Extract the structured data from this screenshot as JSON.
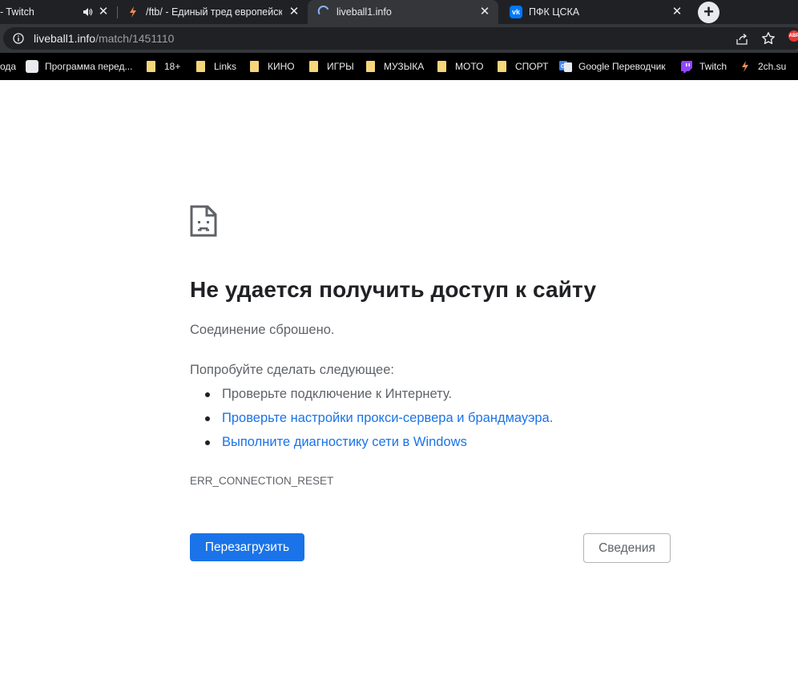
{
  "tabs": [
    {
      "title": "- Twitch",
      "icon": "twitch-audio-tab",
      "audio": true
    },
    {
      "title": "/ftb/ - Единый тред европейско",
      "icon": "2ch-flame-icon"
    },
    {
      "title": "liveball1.info",
      "icon": "loading-spinner-icon",
      "active": true
    },
    {
      "title": "ПФК ЦСКА",
      "icon": "vk-icon"
    }
  ],
  "address": {
    "domain": "liveball1.info",
    "path": "/match/1451110"
  },
  "bookmarks": [
    {
      "label": "ода",
      "icon": "none"
    },
    {
      "label": "Программа перед...",
      "icon": "tv-icon"
    },
    {
      "label": "18+",
      "icon": "folder-icon"
    },
    {
      "label": "Links",
      "icon": "folder-icon"
    },
    {
      "label": "КИНО",
      "icon": "folder-icon"
    },
    {
      "label": "ИГРЫ",
      "icon": "folder-icon"
    },
    {
      "label": "МУЗЫКА",
      "icon": "folder-icon"
    },
    {
      "label": "МОТО",
      "icon": "folder-icon"
    },
    {
      "label": "СПОРТ",
      "icon": "folder-icon"
    },
    {
      "label": "Google Переводчик",
      "icon": "google-translate-icon"
    },
    {
      "label": "Twitch",
      "icon": "twitch-icon"
    },
    {
      "label": "2ch.su",
      "icon": "2ch-flame-icon"
    }
  ],
  "extension_badge": "ABP",
  "error": {
    "title": "Не удается получить доступ к сайту",
    "description": "Соединение сброшено.",
    "suggestions_heading": "Попробуйте сделать следующее:",
    "suggestion_1": "Проверьте подключение к Интернету.",
    "suggestion_2_link": "Проверьте настройки прокси-сервера и брандмауэра",
    "suggestion_2_tail": ".",
    "suggestion_3_link": "Выполните диагностику сети в Windows",
    "code": "ERR_CONNECTION_RESET",
    "reload_label": "Перезагрузить",
    "details_label": "Сведения"
  },
  "colors": {
    "accent": "#1a73e8",
    "tabstrip": "#202124",
    "active_tab": "#35363a",
    "title_text": "#202124",
    "body_text": "#5f6368"
  }
}
